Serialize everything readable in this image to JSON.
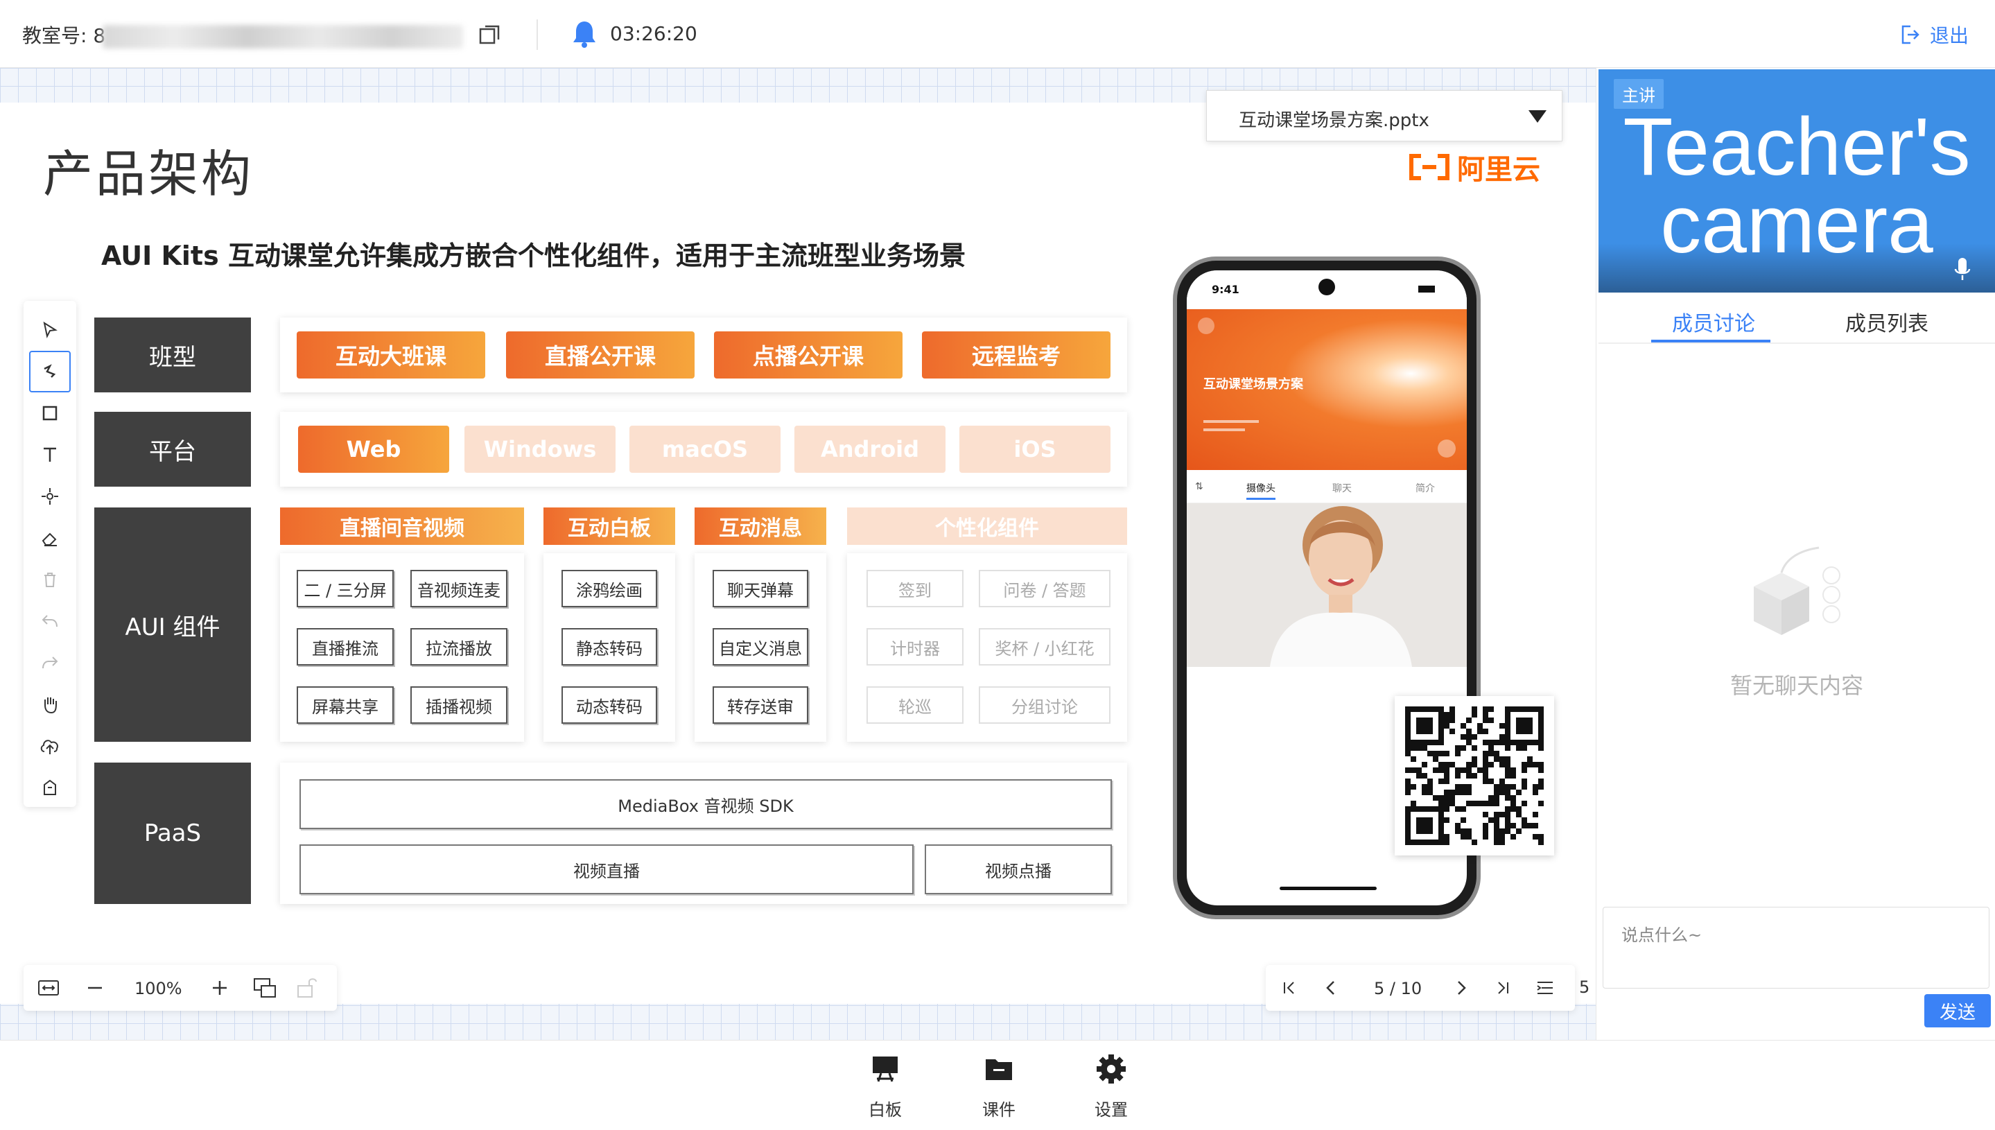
{
  "topbar": {
    "classroom_label": "教室号: 8",
    "timer": "03:26:20",
    "exit_label": "退出"
  },
  "file_select": {
    "selected": "互动课堂场景方案.pptx"
  },
  "slide": {
    "title": "产品架构",
    "subtitle": "AUI Kits 互动课堂允许集成方嵌合个性化组件，适用于主流班型业务场景",
    "logo_text": "阿里云",
    "rows": {
      "class_type": "班型",
      "platform": "平台",
      "aui": "AUI 组件",
      "paas": "PaaS"
    },
    "class_types": [
      "互动大班课",
      "直播公开课",
      "点播公开课",
      "远程监考"
    ],
    "platforms": [
      "Web",
      "Windows",
      "macOS",
      "Android",
      "iOS"
    ],
    "groups": {
      "live_av": {
        "title": "直播间音视频",
        "items": [
          "二 / 三分屏",
          "音视频连麦",
          "直播推流",
          "拉流播放",
          "屏幕共享",
          "插播视频"
        ]
      },
      "whiteboard": {
        "title": "互动白板",
        "items": [
          "涂鸦绘画",
          "静态转码",
          "动态转码"
        ]
      },
      "message": {
        "title": "互动消息",
        "items": [
          "聊天弹幕",
          "自定义消息",
          "转存送审"
        ]
      },
      "custom": {
        "title": "个性化组件",
        "items": [
          "签到",
          "问卷 / 答题",
          "计时器",
          "奖杯 / 小红花",
          "轮巡",
          "分组讨论"
        ]
      }
    },
    "paas": {
      "sdk": "MediaBox 音视频 SDK",
      "live": "视频直播",
      "vod": "视频点播"
    },
    "phone": {
      "time": "9:41",
      "header_title": "互动课堂场景方案",
      "tabs": [
        "摄像头",
        "聊天",
        "简介"
      ]
    }
  },
  "zoom": {
    "value": "100%"
  },
  "pager": {
    "current": "5 / 10",
    "count": "5"
  },
  "right_panel": {
    "camera_tag": "主讲",
    "camera_text": "Teacher's camera",
    "tabs": [
      "成员讨论",
      "成员列表"
    ],
    "empty_text": "暂无聊天内容",
    "input_placeholder": "说点什么~",
    "send_label": "发送"
  },
  "bottom_nav": [
    "白板",
    "课件",
    "设置"
  ],
  "colors": {
    "accent": "#3b82f6",
    "orange": "#ee6a2c",
    "dark_label": "#404040"
  }
}
